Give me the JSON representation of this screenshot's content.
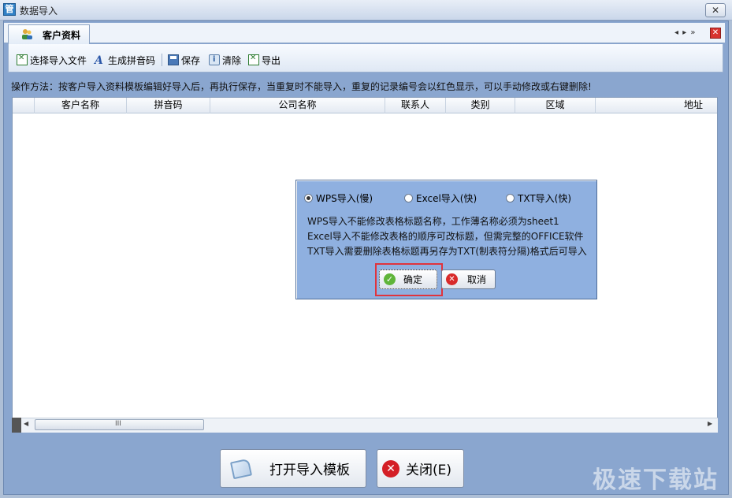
{
  "window": {
    "title": "数据导入",
    "close_glyph": "✕",
    "app_icon": "管"
  },
  "tab": {
    "label": "客户资料",
    "icon": "customer-icon",
    "nav": "◂ ▸ »",
    "close_glyph": "✕"
  },
  "toolbar": {
    "select_file": "选择导入文件",
    "gen_pinyin": "生成拼音码",
    "save": "保存",
    "clear": "清除",
    "export": "导出"
  },
  "instruction": "操作方法：按客户导入资料模板编辑好导入后，再执行保存，当重复时不能导入，重复的记录编号会以红色显示，可以手动修改或右键删除!",
  "grid": {
    "columns": [
      "客户名称",
      "拼音码",
      "公司名称",
      "联系人",
      "类别",
      "区域",
      "地址"
    ],
    "thumb_grip": "III"
  },
  "dialog": {
    "options": [
      {
        "label": "WPS导入(慢)",
        "checked": true
      },
      {
        "label": "Excel导入(快)",
        "checked": false
      },
      {
        "label": "TXT导入(快)",
        "checked": false
      }
    ],
    "notes": [
      "WPS导入不能修改表格标题名称，工作薄名称必须为sheet1",
      "Excel导入不能修改表格的顺序可改标题，但需完整的OFFICE软件",
      "TXT导入需要删除表格标题再另存为TXT(制表符分隔)格式后可导入"
    ],
    "ok_label": "确定",
    "cancel_label": "取消"
  },
  "bottom": {
    "import_template_label": "打开导入模板",
    "close_label": "关闭(E)"
  },
  "watermark": "极速下载站",
  "colors": {
    "dialog_bg": "#8fb0e0",
    "highlight": "#e0343d",
    "frame": "#8aa6cf"
  }
}
